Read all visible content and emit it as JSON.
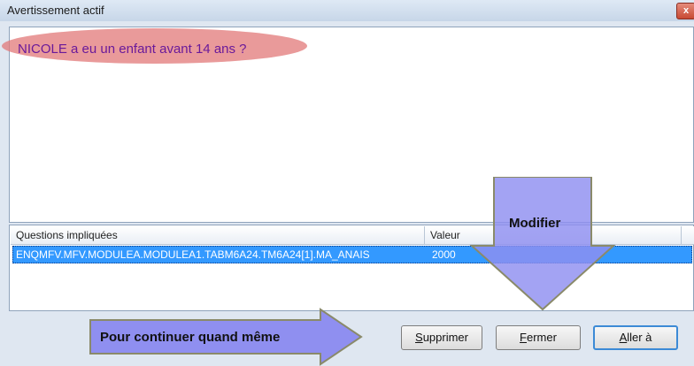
{
  "window": {
    "title": "Avertissement actif",
    "close_glyph": "x"
  },
  "message": {
    "text": "NICOLE a eu un enfant avant 14 ans ?"
  },
  "table": {
    "headers": {
      "question": "Questions impliquées",
      "value": "Valeur"
    },
    "rows": [
      {
        "question": "ENQMFV.MFV.MODULEA.MODULEA1.TABM6A24.TM6A24[1].MA_ANAIS",
        "value": "2000"
      }
    ]
  },
  "annotations": {
    "modify": "Modifier",
    "continue": "Pour continuer quand même"
  },
  "buttons": {
    "delete": {
      "key": "S",
      "rest": "upprimer"
    },
    "close": {
      "key": "F",
      "rest": "ermer"
    },
    "goto": {
      "key": "A",
      "rest": "ller à"
    }
  },
  "colors": {
    "annotation_fill": "#8f8ff0",
    "highlight_ellipse": "#e27878",
    "selected_row": "#3399ff"
  }
}
